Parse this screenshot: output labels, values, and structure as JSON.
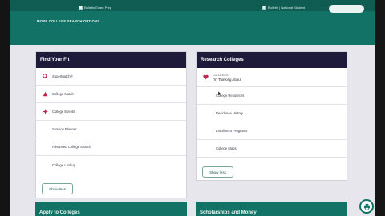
{
  "browser": {
    "tabs": [
      {
        "label": "Bulletin Exam Prep"
      },
      {
        "label": "Bulletin | National Student"
      }
    ]
  },
  "header": {
    "more_options": "MORE COLLEGE SEARCH OPTIONS"
  },
  "find_your_fit": {
    "title": "Find Your Fit",
    "items": [
      {
        "label": "SuperMatch®",
        "icon": "search-icon"
      },
      {
        "label": "College Match",
        "icon": "college-match-icon"
      },
      {
        "label": "College Events",
        "icon": "college-events-icon"
      },
      {
        "label": "Session Planner",
        "icon": ""
      },
      {
        "label": "Advanced College Search",
        "icon": ""
      },
      {
        "label": "College Lookup",
        "icon": ""
      }
    ],
    "show_less": "Show less"
  },
  "research_colleges": {
    "title": "Research Colleges",
    "items": [
      {
        "small": "COLLEGES",
        "label": "I'm Thinking About",
        "icon": "heart-icon"
      },
      {
        "label": "College Resources"
      },
      {
        "label": "Residence History"
      },
      {
        "label": "Enrollment Programs"
      },
      {
        "label": "College Maps"
      }
    ],
    "show_less": "Show less"
  },
  "bottom": {
    "apply": "Apply to Colleges",
    "scholarships": "Scholarships and Money"
  },
  "colors": {
    "teal": "#137266",
    "navy": "#1d1a3a",
    "accent_red": "#c2254e"
  }
}
